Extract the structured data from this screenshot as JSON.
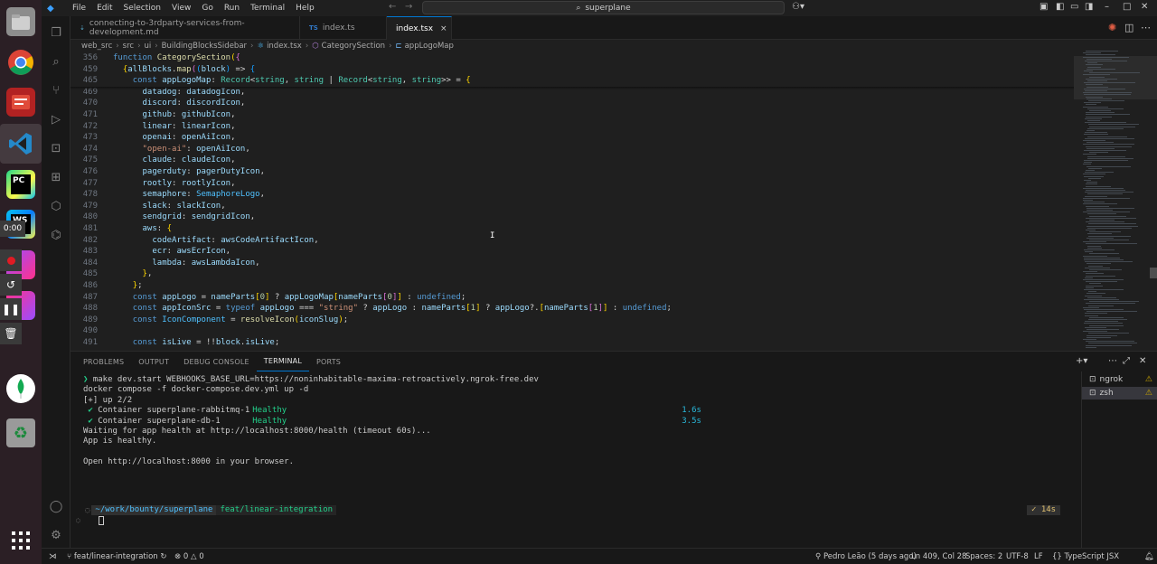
{
  "dock": {
    "recorder_time": "0:00",
    "apps": [
      "files",
      "chrome",
      "app-center",
      "vscode",
      "pycharm",
      "webstorm",
      "recorder",
      "mongodb-compass",
      "trash",
      "app-grid"
    ]
  },
  "menu": [
    "File",
    "Edit",
    "Selection",
    "View",
    "Go",
    "Run",
    "Terminal",
    "Help"
  ],
  "search": {
    "value": "superplane"
  },
  "tabs": [
    {
      "label": "connecting-to-3rdparty-services-from-development.md",
      "icon": "md-icon",
      "active": false
    },
    {
      "label": "index.ts",
      "icon": "TS",
      "active": false
    },
    {
      "label": "index.tsx",
      "icon": "",
      "active": true,
      "close": "×"
    }
  ],
  "breadcrumbs": [
    "web_src",
    "src",
    "ui",
    "BuildingBlocksSidebar",
    "index.tsx",
    "CategorySection",
    "appLogoMap"
  ],
  "editor": {
    "lines": [
      {
        "n": "356",
        "text": "function CategorySection({"
      },
      {
        "n": "459",
        "text": "  {allBlocks.map((block) => {"
      },
      {
        "n": "465",
        "text": "    const appLogoMap: Record<string, string | Record<string, string>> = {"
      },
      {
        "n": "469",
        "text": "      datadog: datadogIcon,"
      },
      {
        "n": "470",
        "text": "      discord: discordIcon,"
      },
      {
        "n": "471",
        "text": "      github: githubIcon,"
      },
      {
        "n": "472",
        "text": "      linear: linearIcon,"
      },
      {
        "n": "473",
        "text": "      openai: openAiIcon,"
      },
      {
        "n": "474",
        "text": "      \"open-ai\": openAiIcon,"
      },
      {
        "n": "475",
        "text": "      claude: claudeIcon,"
      },
      {
        "n": "476",
        "text": "      pagerduty: pagerDutyIcon,"
      },
      {
        "n": "477",
        "text": "      rootly: rootlyIcon,"
      },
      {
        "n": "478",
        "text": "      semaphore: SemaphoreLogo,"
      },
      {
        "n": "479",
        "text": "      slack: slackIcon,"
      },
      {
        "n": "480",
        "text": "      sendgrid: sendgridIcon,"
      },
      {
        "n": "481",
        "text": "      aws: {"
      },
      {
        "n": "482",
        "text": "        codeArtifact: awsCodeArtifactIcon,"
      },
      {
        "n": "483",
        "text": "        ecr: awsEcrIcon,"
      },
      {
        "n": "484",
        "text": "        lambda: awsLambdaIcon,"
      },
      {
        "n": "485",
        "text": "      },"
      },
      {
        "n": "486",
        "text": "    };"
      },
      {
        "n": "487",
        "text": "    const appLogo = nameParts[0] ? appLogoMap[nameParts[0]] : undefined;"
      },
      {
        "n": "488",
        "text": "    const appIconSrc = typeof appLogo === \"string\" ? appLogo : nameParts[1] ? appLogo?.[nameParts[1]] : undefined;"
      },
      {
        "n": "489",
        "text": "    const IconComponent = resolveIcon(iconSlug);"
      },
      {
        "n": "490",
        "text": ""
      },
      {
        "n": "491",
        "text": "    const isLive = !!block.isLive;"
      }
    ]
  },
  "panel": {
    "tabs": [
      "PROBLEMS",
      "OUTPUT",
      "DEBUG CONSOLE",
      "TERMINAL",
      "PORTS"
    ],
    "active_tab": "TERMINAL",
    "terminal": {
      "lines": [
        {
          "prefix": "❯ ",
          "text": "make dev.start WEBHOOKS_BASE_URL=https://noninhabitable-maxima-retroactively.ngrok-free.dev"
        },
        {
          "prefix": "",
          "text": "docker compose -f docker-compose.dev.yml up -d"
        },
        {
          "prefix": "",
          "text": "[+] up 2/2"
        },
        {
          "prefix": " ✔ ",
          "text": "Container superplane-rabbitmq-1",
          "status": "Healthy",
          "time": "1.6s"
        },
        {
          "prefix": " ✔ ",
          "text": "Container superplane-db-1",
          "status": "Healthy",
          "time": "3.5s"
        },
        {
          "prefix": "",
          "text": "Waiting for app health at http://localhost:8000/health (timeout 60s)..."
        },
        {
          "prefix": "",
          "text": "App is healthy."
        },
        {
          "prefix": "",
          "text": ""
        },
        {
          "prefix": "",
          "text": "Open http://localhost:8000 in your browser."
        }
      ],
      "prompt_path": "~/work/bounty/superplane",
      "prompt_branch": "feat/linear-integration",
      "duration": "✓ 14s"
    },
    "terminals": [
      {
        "name": "ngrok",
        "active": false
      },
      {
        "name": "zsh",
        "active": true
      }
    ]
  },
  "statusbar": {
    "branch": "feat/linear-integration",
    "errors": "0",
    "warnings": "0",
    "blame": "Pedro Leão (5 days ago)",
    "position": "Ln 409, Col 28",
    "spaces": "Spaces: 2",
    "encoding": "UTF-8",
    "eol": "LF",
    "language": "TypeScript JSX"
  },
  "colors": {
    "accent": "#0078d4",
    "editor_bg": "#1f1f1f",
    "panel_bg": "#181818",
    "dock_bg": "#2b1f25"
  }
}
